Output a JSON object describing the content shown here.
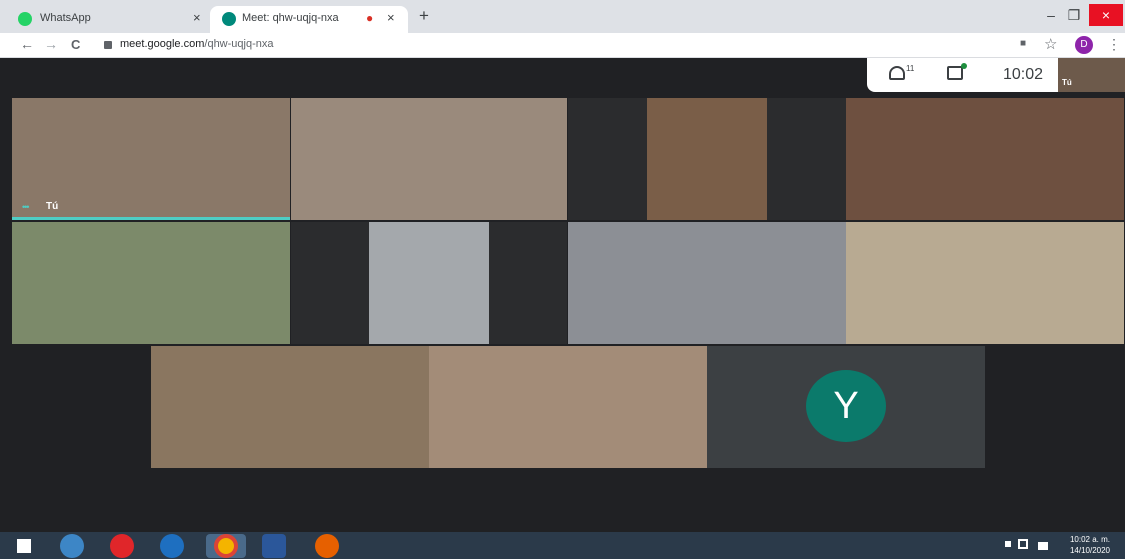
{
  "browser": {
    "tabs": [
      {
        "title": "WhatsApp",
        "close": "×"
      },
      {
        "title": "Meet: qhw-uqjq-nxa",
        "close": "×",
        "recording": "●"
      }
    ],
    "new_tab": "+",
    "window_controls": {
      "minimize": "–",
      "restore": "❐",
      "close": "×"
    },
    "nav": {
      "back": "←",
      "forward": "→",
      "reload": "C"
    },
    "url_host": "meet.google.com",
    "url_path": "/qhw-uqjq-nxa",
    "profile_initial": "D",
    "menu": "⋮",
    "star": "☆",
    "camera_indicator": "■"
  },
  "meet": {
    "participant_count": "11",
    "clock": "10:02",
    "self_preview_label": "Tú",
    "self_tile_label": "Tú",
    "avatar_initial": "Y",
    "avatar_color": "#0b7a6b",
    "dots": "•••"
  },
  "taskbar": {
    "time": "10:02 a. m.",
    "date": "14/10/2020"
  }
}
